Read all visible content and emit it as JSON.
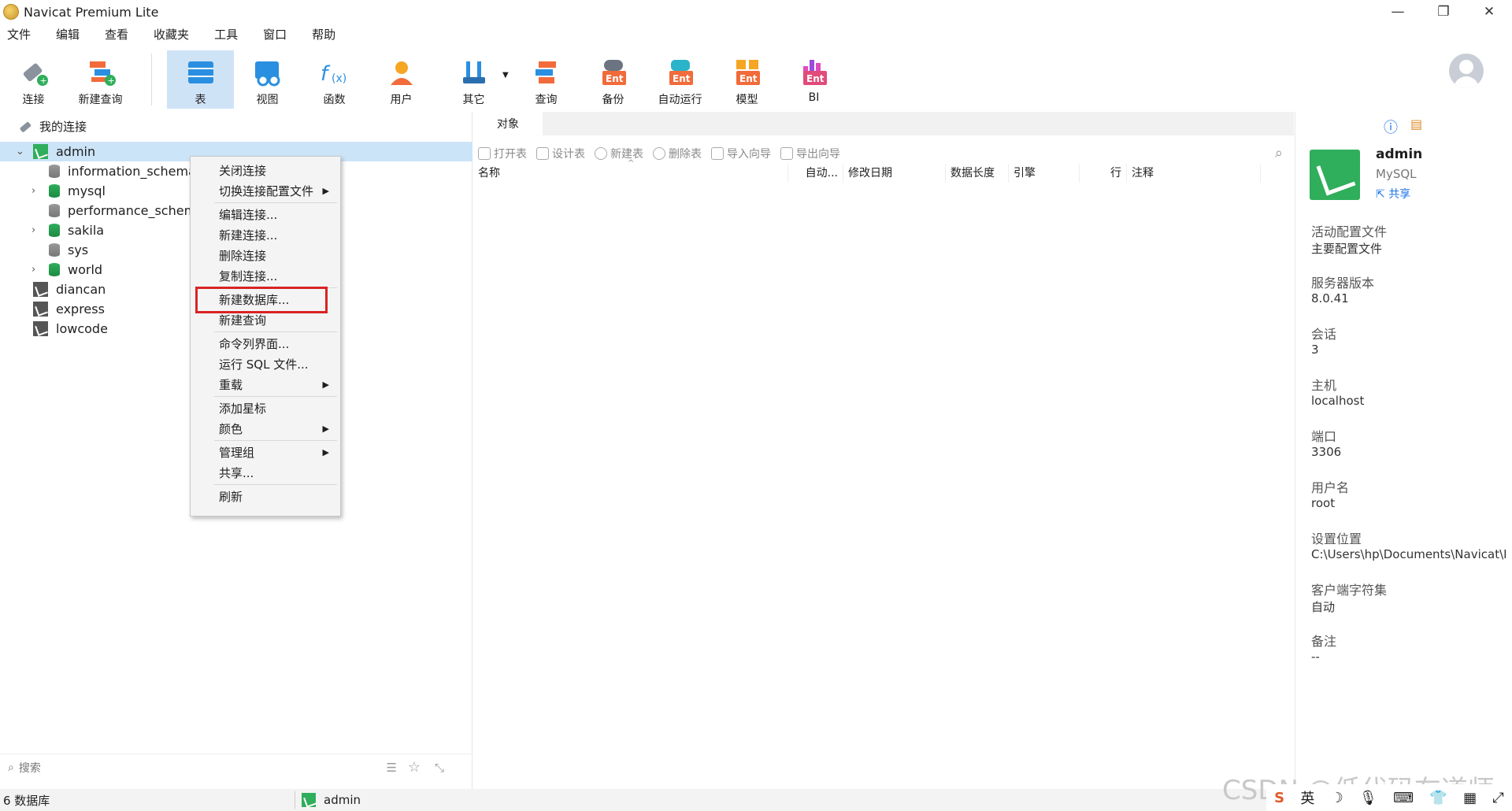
{
  "window": {
    "title": "Navicat Premium Lite"
  },
  "menu": [
    "文件",
    "编辑",
    "查看",
    "收藏夹",
    "工具",
    "窗口",
    "帮助"
  ],
  "toolbar": {
    "connect": "连接",
    "new_query": "新建查询",
    "table": "表",
    "view": "视图",
    "function": "函数",
    "user": "用户",
    "other": "其它",
    "query": "查询",
    "backup": "备份",
    "automation": "自动运行",
    "model": "模型",
    "bi": "BI",
    "ent_badge": "Ent"
  },
  "navigator": {
    "header": "我的连接",
    "active_connection": "admin",
    "databases": [
      {
        "name": "information_schema",
        "color": "grey",
        "expandable": false
      },
      {
        "name": "mysql",
        "color": "green",
        "expandable": true
      },
      {
        "name": "performance_schema",
        "color": "grey",
        "expandable": false
      },
      {
        "name": "sakila",
        "color": "green",
        "expandable": true
      },
      {
        "name": "sys",
        "color": "grey",
        "expandable": false
      },
      {
        "name": "world",
        "color": "green",
        "expandable": true
      }
    ],
    "other_connections": [
      "diancan",
      "express",
      "lowcode"
    ],
    "search_placeholder": "搜索"
  },
  "context_menu": {
    "items": [
      {
        "label": "关闭连接",
        "submenu": false
      },
      {
        "label": "切换连接配置文件",
        "submenu": true
      },
      {
        "label": "编辑连接...",
        "submenu": false
      },
      {
        "label": "新建连接...",
        "submenu": false
      },
      {
        "label": "删除连接",
        "submenu": false
      },
      {
        "label": "复制连接...",
        "submenu": false
      },
      {
        "label": "新建数据库...",
        "submenu": false,
        "highlighted": true
      },
      {
        "label": "新建查询",
        "submenu": false
      },
      {
        "label": "命令列界面...",
        "submenu": false
      },
      {
        "label": "运行 SQL 文件...",
        "submenu": false
      },
      {
        "label": "重载",
        "submenu": true
      },
      {
        "label": "添加星标",
        "submenu": false
      },
      {
        "label": "颜色",
        "submenu": true
      },
      {
        "label": "管理组",
        "submenu": true
      },
      {
        "label": "共享...",
        "submenu": false
      },
      {
        "label": "刷新",
        "submenu": false
      }
    ]
  },
  "center": {
    "tab": "对象",
    "actions": [
      "打开表",
      "设计表",
      "新建表",
      "删除表",
      "导入向导",
      "导出向导"
    ],
    "columns": [
      "名称",
      "自动...",
      "修改日期",
      "数据长度",
      "引擎",
      "行",
      "注释"
    ]
  },
  "info": {
    "name": "admin",
    "type": "MySQL",
    "share": "共享",
    "props": [
      {
        "label": "活动配置文件",
        "value": "主要配置文件"
      },
      {
        "label": "服务器版本",
        "value": "8.0.41"
      },
      {
        "label": "会话",
        "value": "3"
      },
      {
        "label": "主机",
        "value": "localhost"
      },
      {
        "label": "端口",
        "value": "3306"
      },
      {
        "label": "用户名",
        "value": "root"
      },
      {
        "label": "设置位置",
        "value": "C:\\Users\\hp\\Documents\\Navicat\\I"
      },
      {
        "label": "客户端字符集",
        "value": "自动"
      },
      {
        "label": "备注",
        "value": "--"
      }
    ]
  },
  "status": {
    "count": "6 数据库",
    "connection": "admin"
  },
  "watermark": "CSDN @低代码布道师",
  "tray": {
    "ime_lang": "英"
  },
  "colors": {
    "accent": "#1a73e8",
    "selection": "#cce4f7",
    "mysql_green": "#2fae5b",
    "highlight_red": "#d92424"
  }
}
